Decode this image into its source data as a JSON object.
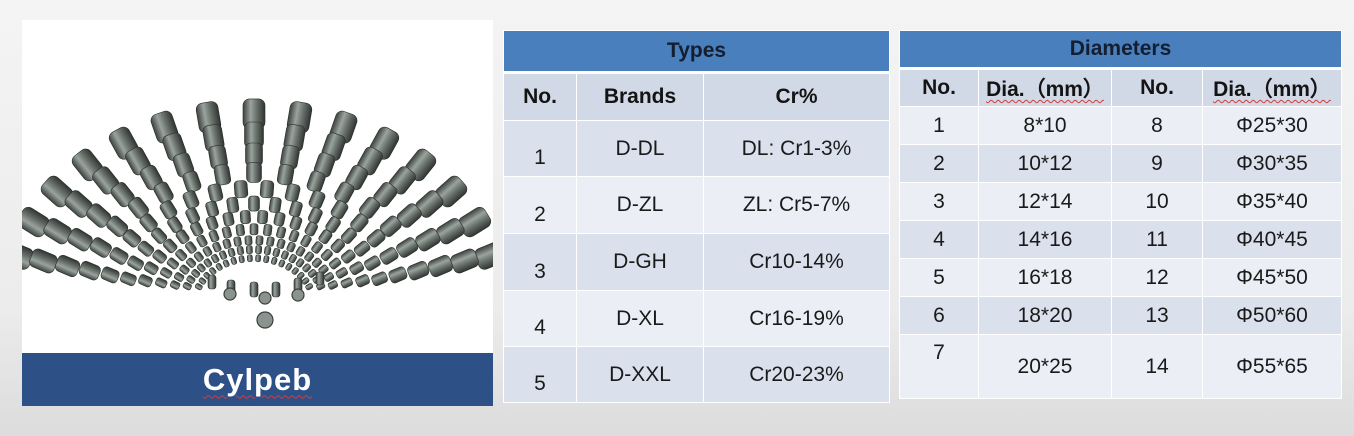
{
  "product": {
    "caption": "Cylpeb",
    "colors": {
      "caption_bg": "#2d5087",
      "caption_text": "#ffffff"
    },
    "image": "fan-arrangement-of-steel-cylpebs"
  },
  "types_table": {
    "title": "Types",
    "headers": [
      "No.",
      "Brands",
      "Cr%"
    ],
    "rows": [
      {
        "no": "1",
        "brand": "D-DL",
        "cr": "DL:  Cr1-3%"
      },
      {
        "no": "2",
        "brand": "D-ZL",
        "cr": "ZL:  Cr5-7%"
      },
      {
        "no": "3",
        "brand": "D-GH",
        "cr": "Cr10-14%"
      },
      {
        "no": "4",
        "brand": "D-XL",
        "cr": "Cr16-19%"
      },
      {
        "no": "5",
        "brand": "D-XXL",
        "cr": "Cr20-23%"
      }
    ]
  },
  "diameters_table": {
    "title": "Diameters",
    "headers": [
      "No.",
      "Dia.（mm）",
      "No.",
      "Dia.（mm）"
    ],
    "rows": [
      {
        "no1": "1",
        "dia1": "8*10",
        "no2": "8",
        "dia2": "Φ25*30"
      },
      {
        "no1": "2",
        "dia1": "10*12",
        "no2": "9",
        "dia2": "Φ30*35"
      },
      {
        "no1": "3",
        "dia1": "12*14",
        "no2": "10",
        "dia2": "Φ35*40"
      },
      {
        "no1": "4",
        "dia1": "14*16",
        "no2": "11",
        "dia2": "Φ40*45"
      },
      {
        "no1": "5",
        "dia1": "16*18",
        "no2": "12",
        "dia2": "Φ45*50"
      },
      {
        "no1": "6",
        "dia1": "18*20",
        "no2": "13",
        "dia2": "Φ50*60"
      },
      {
        "no1": "7",
        "dia1": "20*25",
        "no2": "14",
        "dia2": "Φ55*65"
      }
    ]
  },
  "colors": {
    "title_bar": "#4a7fbe",
    "header_row": "#d2d9e6",
    "row_dark": "#dae1ec",
    "row_light": "#ebeff5"
  }
}
